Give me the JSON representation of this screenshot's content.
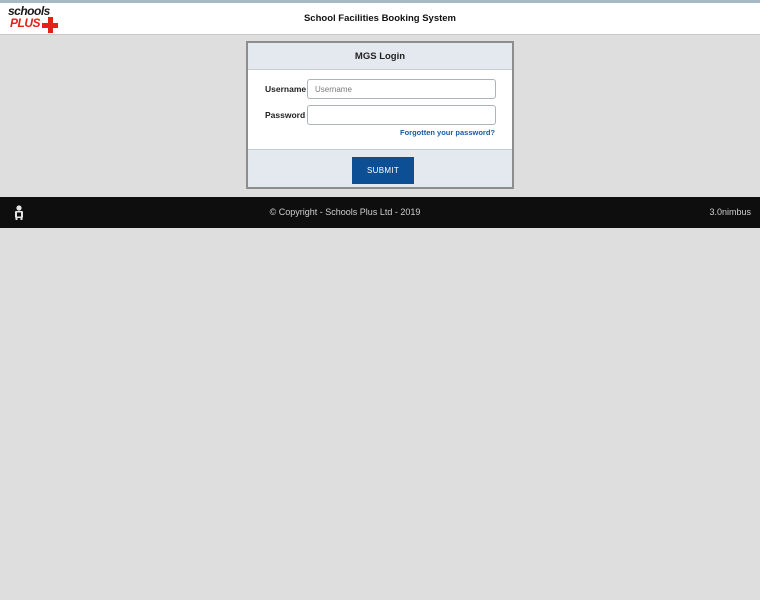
{
  "header": {
    "logo_text_top": "schools",
    "logo_text_bottom": "PLUS",
    "title": "School Facilities Booking System"
  },
  "login": {
    "title": "MGS Login",
    "username_label": "Username",
    "username_placeholder": "Username",
    "username_value": "",
    "password_label": "Password",
    "password_value": "",
    "forgot_link": "Forgotten your password?",
    "submit_label": "SUBMIT"
  },
  "footer": {
    "icon": "user-agent-icon",
    "copyright": "© Copyright - Schools Plus Ltd - 2019",
    "version": "3.0nimbus"
  },
  "colors": {
    "page_bg": "#dedede",
    "brand_red": "#e32119",
    "button_blue": "#0d4f94",
    "link_blue": "#1a5aa6",
    "panel_header_bg": "#e3e9ee",
    "footer_bg": "#0e0e0e"
  }
}
